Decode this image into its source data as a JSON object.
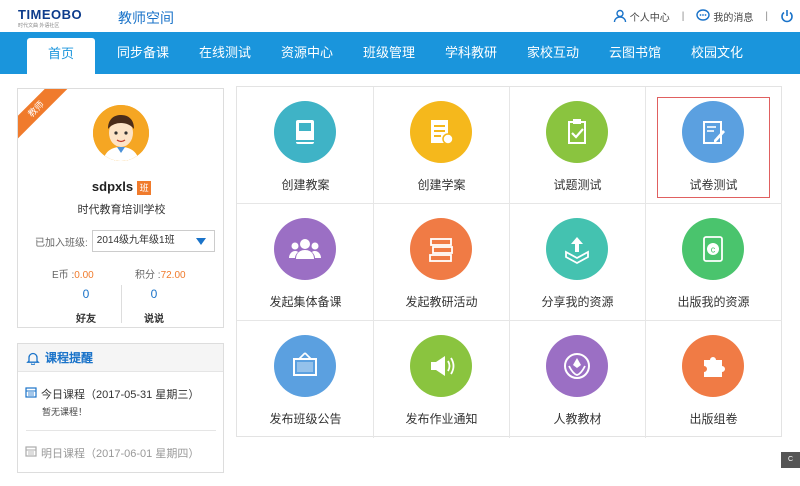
{
  "header": {
    "logo_text": "TIMEOBO",
    "logo_sub": "时代文曲  外语社区",
    "site_title": "教师空间",
    "links": [
      {
        "label": "个人中心",
        "icon": "user-icon"
      },
      {
        "label": "我的消息",
        "icon": "message-icon"
      },
      {
        "label": "",
        "icon": "power-icon"
      }
    ]
  },
  "nav": {
    "items": [
      "首页",
      "同步备课",
      "在线测试",
      "资源中心",
      "班级管理",
      "学科教研",
      "家校互动",
      "云图书馆",
      "校园文化"
    ],
    "active_index": 0
  },
  "profile": {
    "ribbon": "教师",
    "username": "sdpxls",
    "badge": "班",
    "school": "时代教育培训学校",
    "class_label": "已加入班级:",
    "class_value": "2014级九年级1班",
    "coins_label": "E币 :",
    "coins_value": "0.00",
    "points_label": "积分 :",
    "points_value": "72.00",
    "friends_count": "0",
    "friends_label": "好友",
    "talk_count": "0",
    "talk_label": "说说"
  },
  "course": {
    "title": "课程提醒",
    "today": "今日课程（2017-05-31 星期三）",
    "today_note": "暂无课程！",
    "tomorrow": "明日课程（2017-06-01 星期四）"
  },
  "grid": [
    {
      "label": "创建教案",
      "icon": "book-icon",
      "color": "#3fb3c6"
    },
    {
      "label": "创建学案",
      "icon": "document-icon",
      "color": "#f5b81c"
    },
    {
      "label": "试题测试",
      "icon": "clipboard-check-icon",
      "color": "#8ac43f"
    },
    {
      "label": "试卷测试",
      "icon": "paper-edit-icon",
      "color": "#5ba0e0"
    },
    {
      "label": "发起集体备课",
      "icon": "group-icon",
      "color": "#9b6fc4"
    },
    {
      "label": "发起教研活动",
      "icon": "books-stack-icon",
      "color": "#f07b45"
    },
    {
      "label": "分享我的资源",
      "icon": "share-upload-icon",
      "color": "#44c2b0"
    },
    {
      "label": "出版我的资源",
      "icon": "publish-coin-icon",
      "color": "#4ac46d"
    },
    {
      "label": "发布班级公告",
      "icon": "notice-board-icon",
      "color": "#5ba0e0"
    },
    {
      "label": "发布作业通知",
      "icon": "megaphone-icon",
      "color": "#8ac43f"
    },
    {
      "label": "人教教材",
      "icon": "textbook-emblem-icon",
      "color": "#9b6fc4"
    },
    {
      "label": "出版组卷",
      "icon": "puzzle-icon",
      "color": "#f07b45"
    }
  ],
  "corner_text": "C"
}
